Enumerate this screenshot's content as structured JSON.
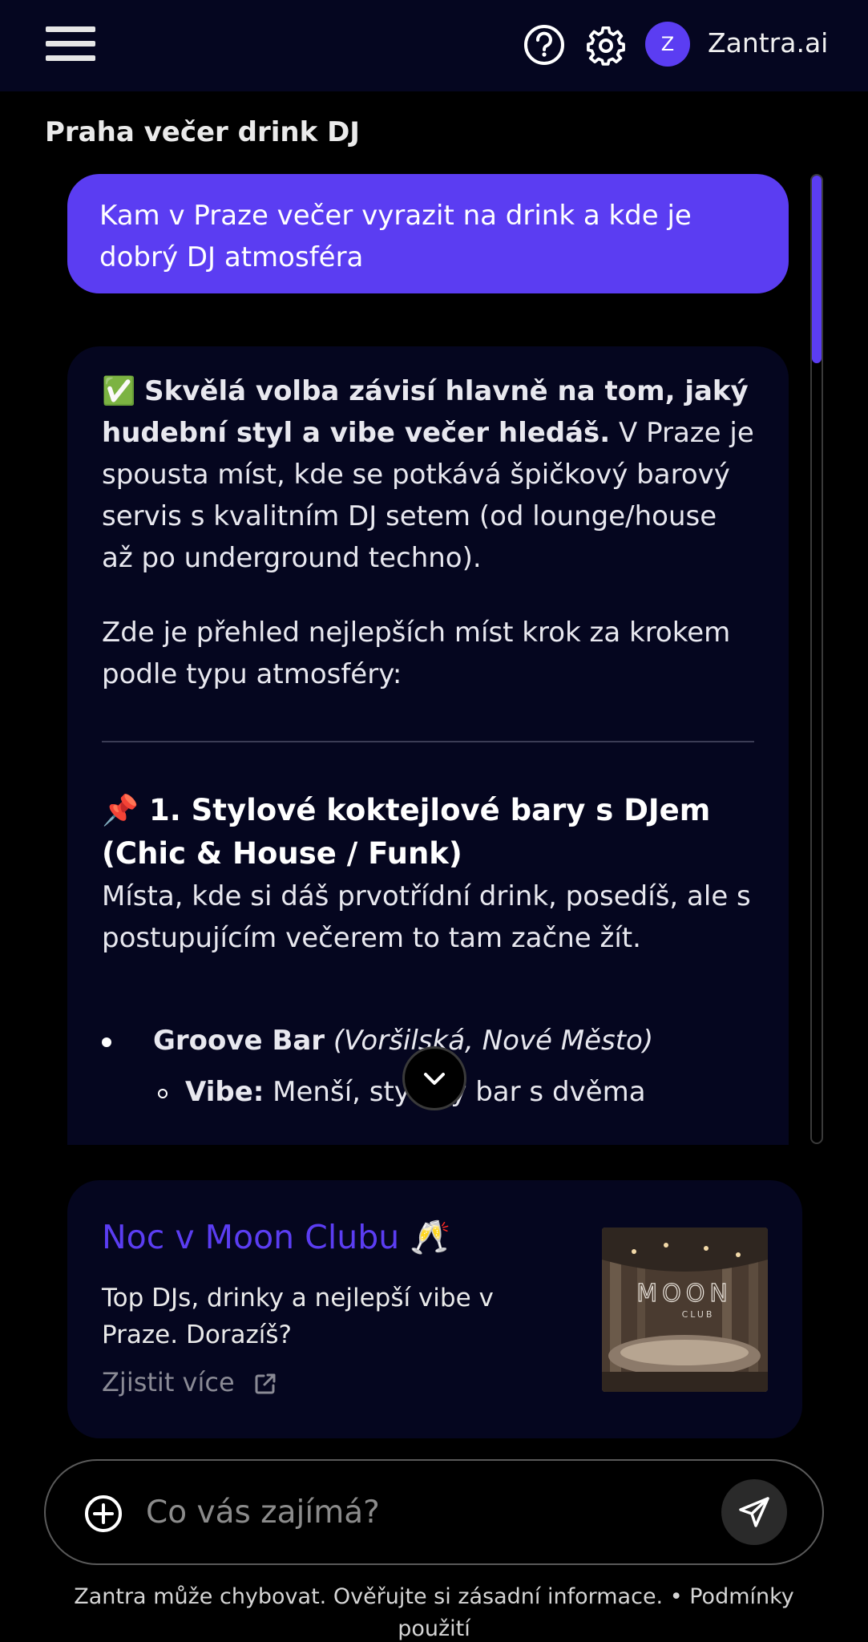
{
  "header": {
    "brand": "Zantra.ai",
    "avatar_letter": "Z",
    "icons": [
      "menu-icon",
      "help-icon",
      "gear-icon"
    ]
  },
  "chat": {
    "title": "Praha večer drink DJ",
    "user_message": "Kam v Praze večer vyrazit na drink a kde je dobrý DJ atmosféra",
    "answer": {
      "intro_emoji": "✅",
      "intro_bold": "Skvělá volba závisí hlavně na tom, jaký hudební styl a vibe večer hledáš.",
      "intro_rest": " V Praze je spousta míst, kde se potkává špičkový barový servis s kvalitním DJ setem (od lounge/house až po underground techno).",
      "p2": "Zde je přehled nejlepších míst krok za krokem podle typu atmosféry:",
      "h3_emoji": "📌",
      "h3": "1. Stylové koktejlové bary s DJem (Chic & House / Funk)",
      "p3": "Místa, kde si dáš prvotřídní drink, posedíš, ale s postupujícím večerem to tam začne žít.",
      "item1_bold": "Groove Bar",
      "item1_italic": " (Voršilská, Nové Město)",
      "sub1_bold": "Vibe:",
      "sub1_text": " Menší, stylový bar s dvěma"
    }
  },
  "promo": {
    "title": "Noc v Moon Clubu 🥂",
    "description": "Top DJs, drinky a nejlepší vibe v Praze. Dorazíš?",
    "cta": "Zjistit více",
    "image_text": "MOON",
    "image_subtext": "CLUB"
  },
  "composer": {
    "placeholder": "Co vás zajímá?"
  },
  "footer": {
    "disclaimer": "Zantra může chybovat. Ověřujte si zásadní informace. • Podmínky použití"
  },
  "colors": {
    "accent": "#5b3df2",
    "card_bg": "#05061f",
    "topbar_bg": "#050620",
    "page_bg": "#000000"
  }
}
